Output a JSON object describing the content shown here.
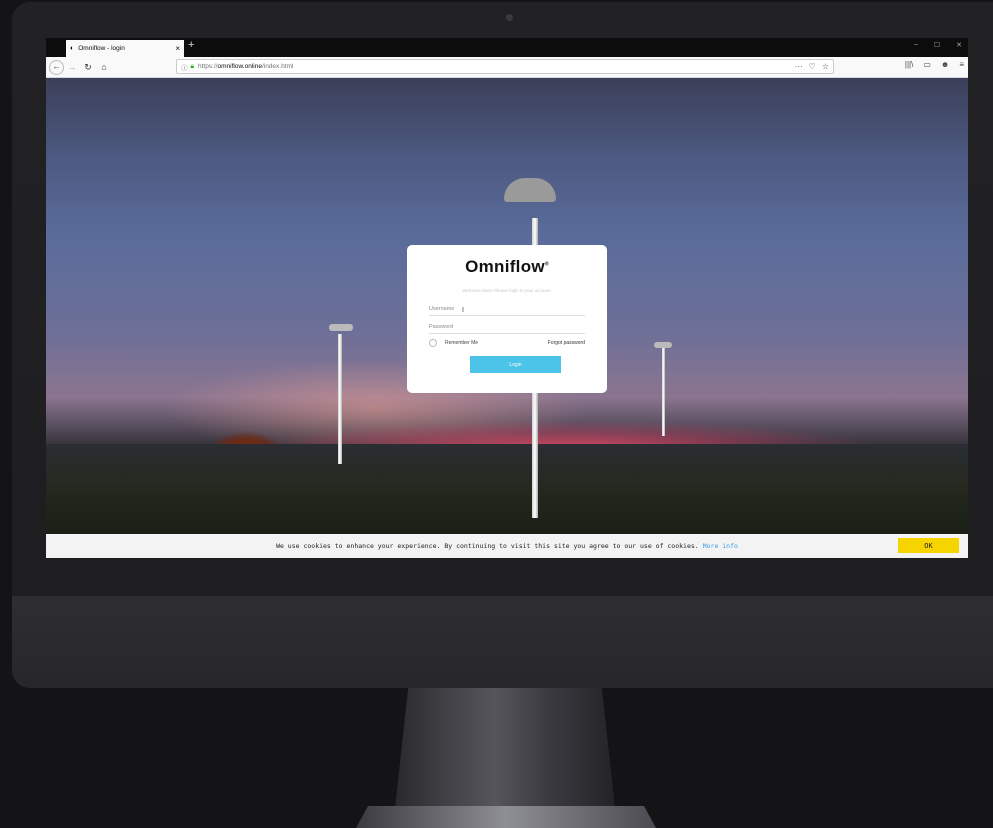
{
  "browser": {
    "tab_title": "Omniflow - login",
    "tab_close": "×",
    "new_tab": "+",
    "window_controls": [
      "–",
      "☐",
      "✕"
    ],
    "url_protocol": "https://",
    "url_domain": "omniflow.online",
    "url_path": "/index.html",
    "url_actions": [
      "···",
      "♡",
      "☆"
    ],
    "nav_right": [
      "|||\\",
      "▭",
      "☻",
      "≡"
    ]
  },
  "login": {
    "logo": "Omniflow",
    "logo_mark": "®",
    "welcome": "Welcome back! Please login to your account.",
    "username_placeholder": "Username",
    "password_placeholder": "Password",
    "remember_label": "Remember Me",
    "forgot_label": "Forgot password",
    "login_label": "Login"
  },
  "cookie": {
    "message": "We use cookies to enhance your experience. By continuing to visit this site you agree to our use of cookies.",
    "more_info": "More info",
    "ok_label": "OK"
  },
  "colors": {
    "login_button": "#4cc3e8",
    "ok_button": "#f5d400",
    "more_info_link": "#3aa0e0"
  }
}
